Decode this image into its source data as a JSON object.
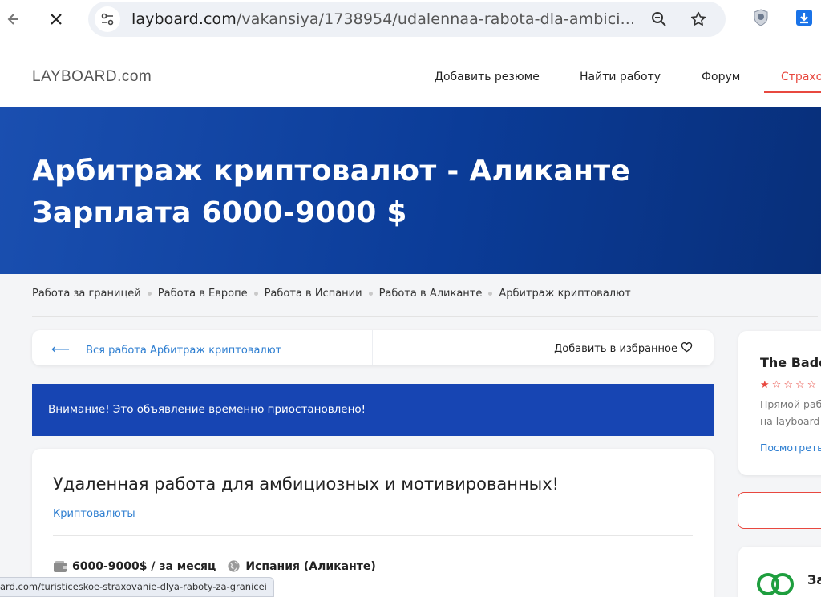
{
  "browser": {
    "url_host": "layboard.com",
    "url_path": "/vakansiya/1738954/udalennaa-rabota-dla-ambici...",
    "status_url": "ard.com/turisticeskoe-straxovanie-dlya-raboty-za-granicei"
  },
  "site": {
    "logo": "LAYBOARD.com",
    "menu": [
      "Добавить резюме",
      "Найти работу",
      "Форум",
      "Страхо"
    ]
  },
  "hero": {
    "title_line1": "Арбитраж криптовалют - Аликанте",
    "title_line2": "Зарплата 6000-9000 $"
  },
  "breadcrumbs": [
    "Работа за границей",
    "Работа в Европе",
    "Работа в Испании",
    "Работа в Аликанте",
    "Арбитраж криптовалют"
  ],
  "actions": {
    "back_arrow": "⟵",
    "back_label": "Вся работа Арбитраж криптовалют",
    "favorite_label": "Добавить в избранное"
  },
  "warning": "Внимание! Это объявление временно приостановлено!",
  "vacancy": {
    "title": "Удаленная работа для амбициозных и мотивированных!",
    "category": "Криптовалюты",
    "salary": "6000-9000$ / за месяц",
    "location": "Испания (Аликанте)"
  },
  "sidebar": {
    "company": "The Badd",
    "rating": 1,
    "rating_max": 5,
    "desc_line1": "Прямой раб",
    "desc_line2": "на layboard",
    "more": "Посмотреть",
    "card2_title": "За"
  },
  "colors": {
    "accent_red": "#e8483f",
    "hero_blue": "#0b3c98",
    "warning_blue": "#1745b3",
    "link_blue": "#2f7fd1"
  }
}
